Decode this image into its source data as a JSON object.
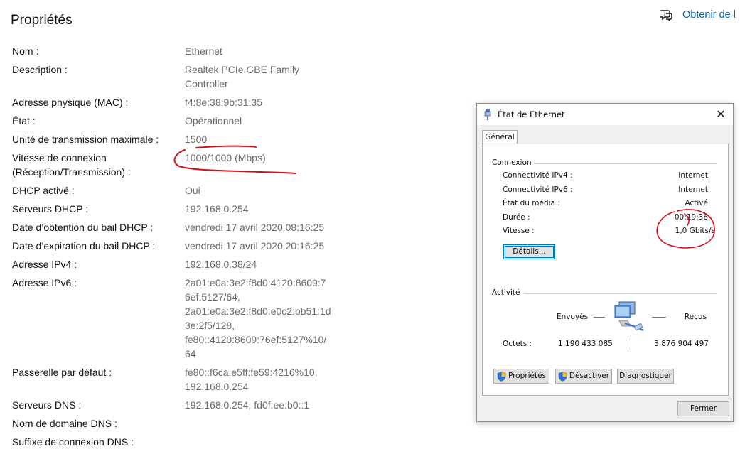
{
  "page": {
    "title": "Propriétés",
    "help_link": "Obtenir de l"
  },
  "properties": [
    {
      "label": "Nom :",
      "value": "Ethernet"
    },
    {
      "label": "Description :",
      "value": [
        "Realtek PCIe GBE Family",
        "Controller"
      ]
    },
    {
      "label": "Adresse physique (MAC) :",
      "value": "f4:8e:38:9b:31:35"
    },
    {
      "label": "État :",
      "value": "Opérationnel"
    },
    {
      "label": "Unité de transmission maximale :",
      "value": "1500"
    },
    {
      "label": [
        "Vitesse de connexion",
        "(Réception/Transmission) :"
      ],
      "value": "1000/1000 (Mbps)"
    },
    {
      "label": "DHCP activé :",
      "value": "Oui"
    },
    {
      "label": "Serveurs DHCP :",
      "value": "192.168.0.254"
    },
    {
      "label": "Date d’obtention du bail DHCP :",
      "value": "vendredi 17 avril 2020 08:16:25"
    },
    {
      "label": "Date d’expiration du bail DHCP :",
      "value": "vendredi 17 avril 2020 20:16:25"
    },
    {
      "label": "Adresse IPv4 :",
      "value": "192.168.0.38/24"
    },
    {
      "label": "Adresse IPv6 :",
      "value": [
        "2a01:e0a:3e2:f8d0:4120:8609:7",
        "6ef:5127/64,",
        "2a01:e0a:3e2:f8d0:e0c2:bb51:1d",
        "3e:2f5/128,",
        "fe80::4120:8609:76ef:5127%10/",
        "64"
      ]
    },
    {
      "label": "Passerelle par défaut :",
      "value": [
        "fe80::f6ca:e5ff:fe59:4216%10,",
        "192.168.0.254"
      ]
    },
    {
      "label": "Serveurs DNS :",
      "value": "192.168.0.254, fd0f:ee:b0::1"
    },
    {
      "label": "Nom de domaine DNS :",
      "value": ""
    },
    {
      "label": "Suffixe de connexion DNS :",
      "value": ""
    }
  ],
  "dialog": {
    "title": "État de Ethernet",
    "close_glyph": "✕",
    "tab": "Général",
    "connection": {
      "group": "Connexion",
      "rows": [
        {
          "label": "Connectivité IPv4 :",
          "value": "Internet"
        },
        {
          "label": "Connectivité IPv6 :",
          "value": "Internet"
        },
        {
          "label": "État du média :",
          "value": "Activé"
        },
        {
          "label": "Durée :",
          "value": "00:19:36"
        },
        {
          "label": "Vitesse :",
          "value": "1,0 Gbits/s"
        }
      ],
      "details_button": "Détails..."
    },
    "activity": {
      "group": "Activité",
      "sent_label": "Envoyés",
      "received_label": "Reçus",
      "bytes_label": "Octets :",
      "bytes_sent": "1 190 433 085",
      "bytes_received": "3 876 904 497"
    },
    "buttons": {
      "properties": "Propriétés",
      "disable": "Désactiver",
      "diagnose": "Diagnostiquer",
      "close": "Fermer"
    }
  },
  "colors": {
    "link": "#0063b1",
    "annotation": "#d0101a",
    "focus": "#0078d7"
  }
}
